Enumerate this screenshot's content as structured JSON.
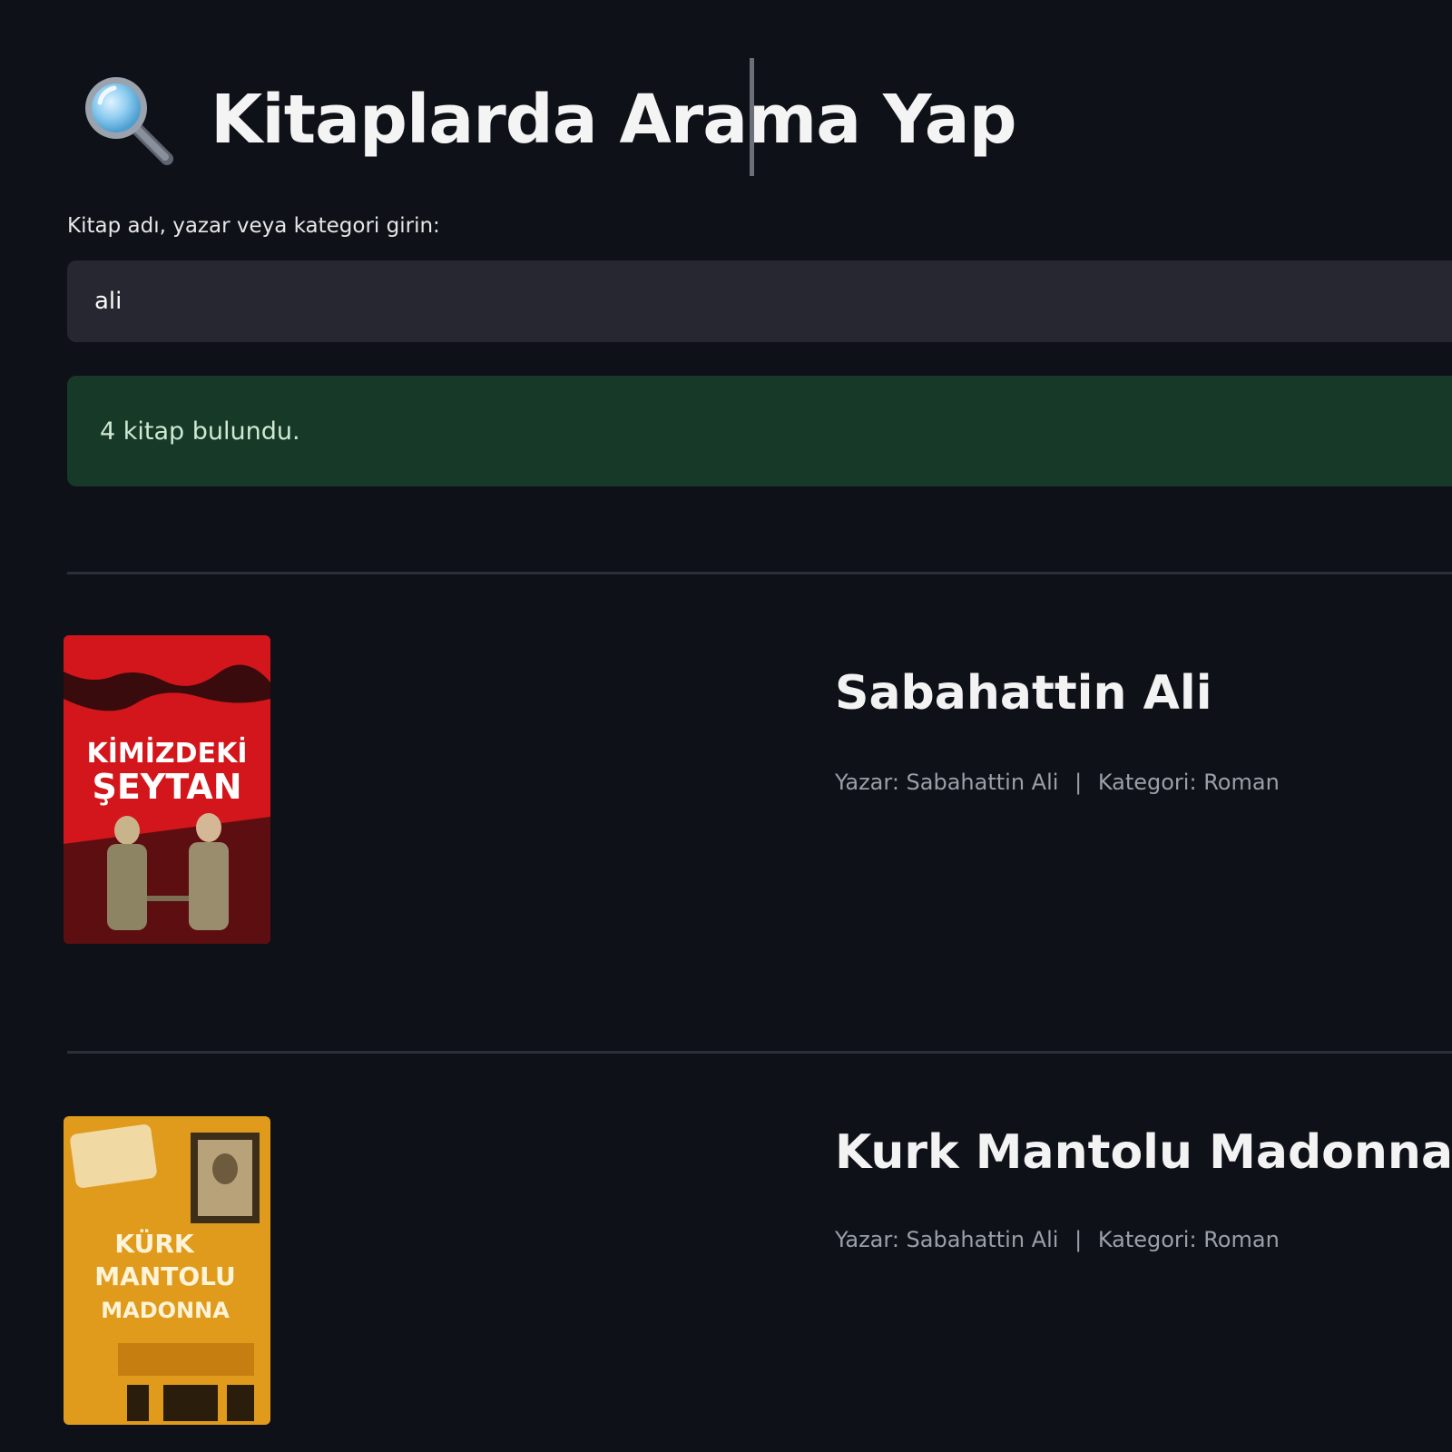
{
  "header": {
    "icon": "magnifying-glass-icon",
    "title": "Kitaplarda Arama Yap"
  },
  "search": {
    "label": "Kitap adı, yazar veya kategori girin:",
    "value": "ali",
    "placeholder": ""
  },
  "alert": {
    "text": "4 kitap bulundu."
  },
  "results": [
    {
      "cover_title": "KİMİZDEKİ ŞEYTAN",
      "title": "Sabahattin Ali",
      "author_label": "Yazar:",
      "author": "Sabahattin Ali",
      "separator": "|",
      "category_label": "Kategori:",
      "category": "Roman"
    },
    {
      "cover_title": "KÜRK MANTOLU MADONNA",
      "title": "Kurk Mantolu Madonna",
      "author_label": "Yazar:",
      "author": "Sabahattin Ali",
      "separator": "|",
      "category_label": "Kategori:",
      "category": "Roman"
    }
  ],
  "colors": {
    "background": "#0e1117",
    "input_background": "#262730",
    "alert_background": "#173928",
    "alert_text": "#cfe9d3",
    "cover1_red": "#d3161b",
    "cover2_yellow": "#e09b1c"
  }
}
